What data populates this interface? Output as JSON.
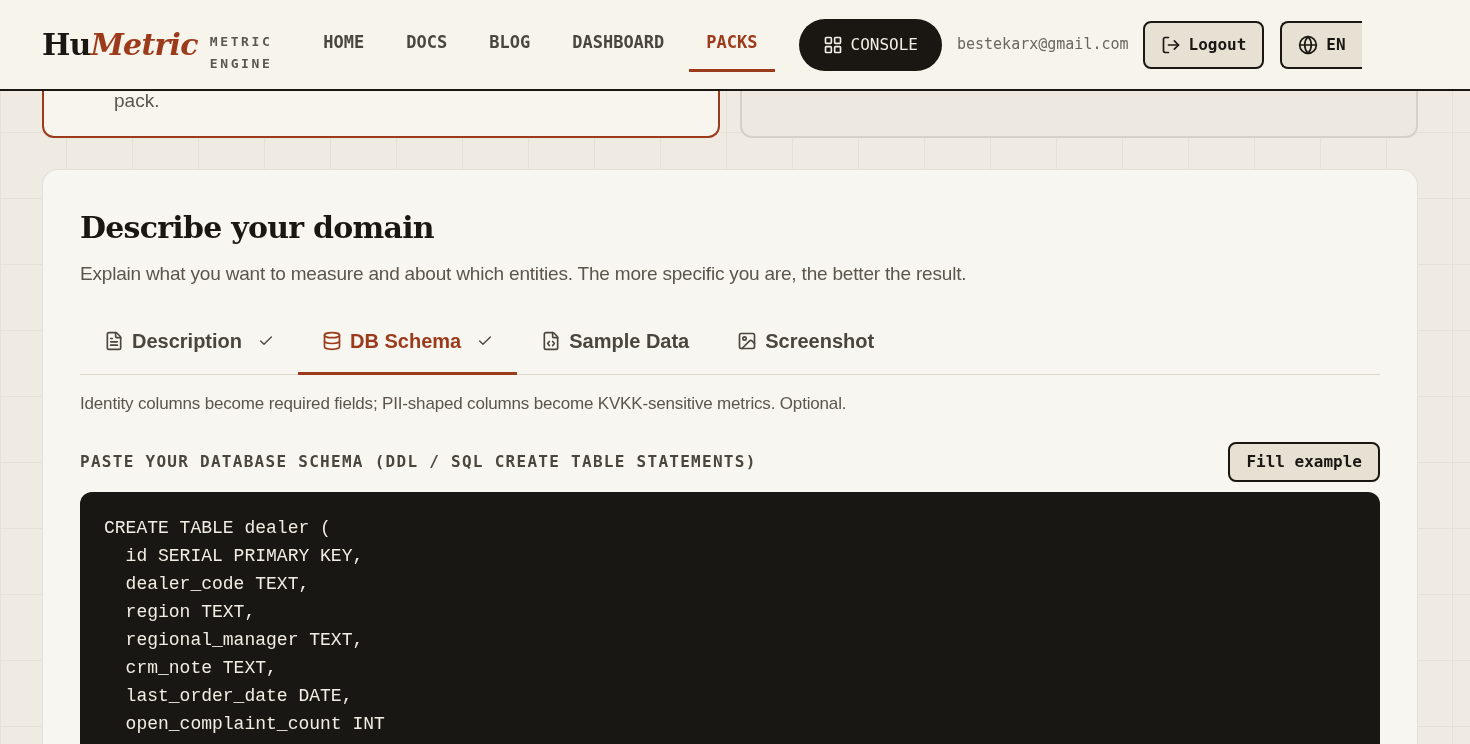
{
  "header": {
    "logo": {
      "part_1": "Hu",
      "part_2": "Metric"
    },
    "tagline": [
      "METRIC",
      "ENGINE"
    ],
    "nav": [
      {
        "label": "HOME",
        "selected": false
      },
      {
        "label": "DOCS",
        "selected": false
      },
      {
        "label": "BLOG",
        "selected": false
      },
      {
        "label": "DASHBOARD",
        "selected": false
      },
      {
        "label": "PACKS",
        "selected": true
      }
    ],
    "console_button": "CONSOLE",
    "email": "bestekarx@gmail.com",
    "logout_button": "Logout",
    "language_button": "EN"
  },
  "previous_cards": [
    {
      "text": "pack.",
      "selected": true
    },
    {
      "selected": false
    }
  ],
  "domain_card": {
    "title": "Describe your domain",
    "subtitle": "Explain what you want to measure and about which entities. The more specific you are, the better the result.",
    "tabs": [
      {
        "kind": "document",
        "label": "Description",
        "done": true,
        "selected": false
      },
      {
        "kind": "database",
        "label": "DB Schema",
        "done": true,
        "selected": true
      },
      {
        "kind": "code-file",
        "label": "Sample Data",
        "done": false,
        "selected": false
      },
      {
        "kind": "image",
        "label": "Screenshot",
        "done": false,
        "selected": false
      }
    ],
    "hint": "Identity columns become required fields; PII-shaped columns become KVKK-sensitive metrics. Optional.",
    "field_label": "PASTE YOUR DATABASE SCHEMA (DDL / SQL CREATE TABLE STATEMENTS)",
    "fill_example_button": "Fill example",
    "schema_lines": [
      "CREATE TABLE dealer (",
      "  id SERIAL PRIMARY KEY,",
      "  dealer_code TEXT,",
      "  region TEXT,",
      "  regional_manager TEXT,",
      "  crm_note TEXT,",
      "  last_order_date DATE,",
      "  open_complaint_count INT"
    ]
  }
}
